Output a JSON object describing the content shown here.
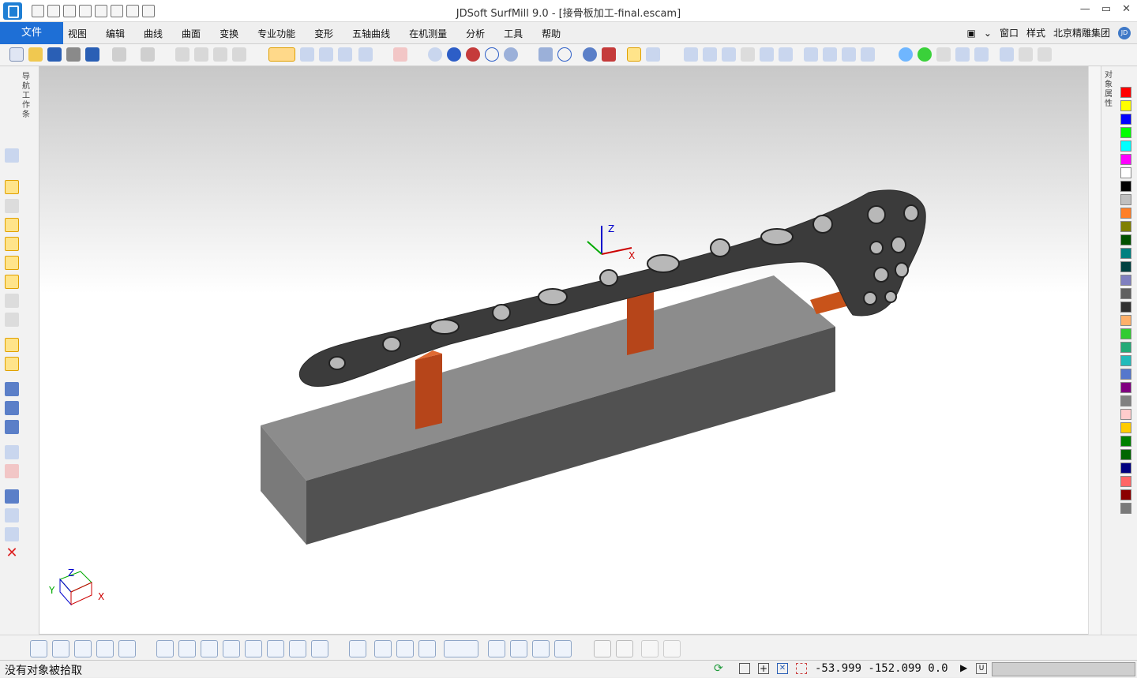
{
  "window": {
    "title": "JDSoft SurfMill 9.0 - [接骨板加工-final.escam]",
    "controls": [
      "—",
      "▭",
      "✕"
    ]
  },
  "menu": {
    "file": "文件",
    "items": [
      "视图",
      "编辑",
      "曲线",
      "曲面",
      "变换",
      "专业功能",
      "变形",
      "五轴曲线",
      "在机测量",
      "分析",
      "工具",
      "帮助"
    ],
    "right": {
      "window": "窗口",
      "style": "样式",
      "company": "北京精雕集团",
      "avatar": "JD"
    }
  },
  "panels": {
    "left_label": "导航工作条",
    "right_label": "对象属性"
  },
  "viewport": {
    "axis_labels": {
      "x": "X",
      "y": "Y",
      "z": "Z"
    },
    "colors": {
      "block": "#6f6f6f",
      "support": "#c8531a",
      "plate": "#3b3b3b"
    }
  },
  "colors_palette": [
    "#ff0000",
    "#ffff00",
    "#0000ff",
    "#00ff00",
    "#00ffff",
    "#ff00ff",
    "#ffffff",
    "#000000",
    "#c0c0c0",
    "#ff7f27",
    "#808000",
    "#005000",
    "#008080",
    "#004040",
    "#7f7fbf",
    "#606060",
    "#303030",
    "#ffb06a",
    "#33cc33",
    "#22aa77",
    "#22bbbb",
    "#5577cc",
    "#800080",
    "#808080",
    "#ffcccc",
    "#ffcc00",
    "#008000",
    "#006600",
    "#000080",
    "#ff6666",
    "#8b0000",
    "#7a7a7a"
  ],
  "statusbar": {
    "message": "没有对象被拾取",
    "coords": "-53.999 -152.099 0.0",
    "unit": "U"
  }
}
